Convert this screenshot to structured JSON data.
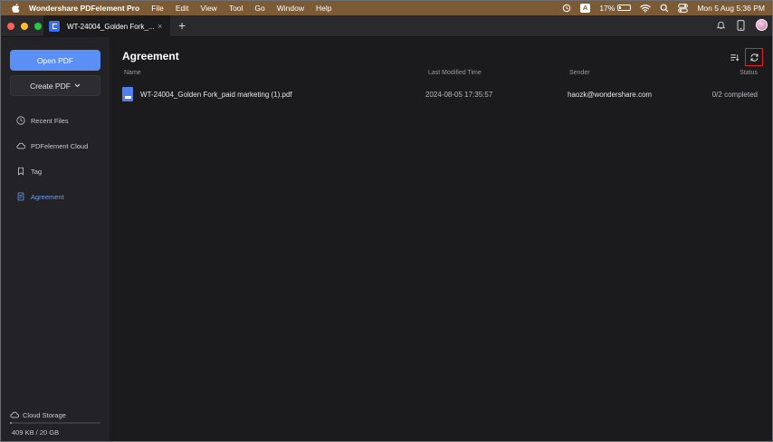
{
  "menubar": {
    "app_name": "Wondershare PDFelement Pro",
    "menus": [
      "File",
      "Edit",
      "View",
      "Tool",
      "Go",
      "Window",
      "Help"
    ],
    "input_source": "A",
    "battery": "17%",
    "battery_level": 0.17,
    "datetime": "Mon 5 Aug  5:36 PM"
  },
  "tabbar": {
    "tab_title": "WT-24004_Golden Fork_...",
    "close_glyph": "×",
    "new_tab_glyph": "+"
  },
  "sidebar": {
    "open_pdf": "Open PDF",
    "create_pdf": "Create PDF",
    "items": [
      {
        "label": "Recent Files",
        "icon": "clock-icon"
      },
      {
        "label": "PDFelement Cloud",
        "icon": "cloud-icon"
      },
      {
        "label": "Tag",
        "icon": "tag-icon"
      },
      {
        "label": "Agreement",
        "icon": "agreement-icon",
        "active": true
      }
    ],
    "cloud_storage": "Cloud Storage",
    "storage_used": "409 KB / 20 GB",
    "storage_fraction": 2e-05
  },
  "main": {
    "title": "Agreement",
    "columns": {
      "name": "Name",
      "modified": "Last Modified Time",
      "sender": "Sender",
      "status": "Status"
    },
    "rows": [
      {
        "name": "WT-24004_Golden Fork_paid marketing (1).pdf",
        "modified": "2024-08-05 17:35:57",
        "sender": "haozk@wondershare.com",
        "status": "0/2 completed"
      }
    ]
  },
  "colors": {
    "accent": "#5a8ff5",
    "active_nav": "#6b9cff",
    "highlight_box": "#e0252a",
    "menubar": "#7b5a36"
  }
}
